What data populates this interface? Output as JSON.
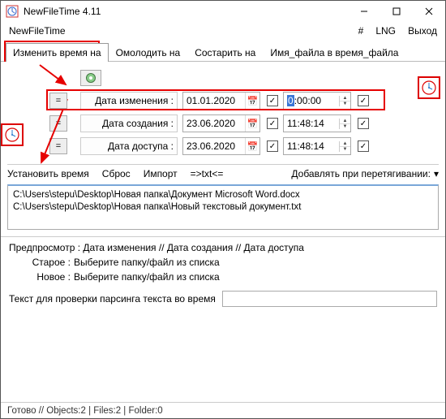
{
  "window": {
    "title": "NewFileTime 4.11"
  },
  "toprow": {
    "appname": "NewFileTime",
    "hash": "#",
    "lng": "LNG",
    "exit": "Выход"
  },
  "tabs": {
    "change": "Изменить время на",
    "young": "Омолодить на",
    "age": "Состарить на",
    "fname": "Имя_файла в время_файла"
  },
  "rows": {
    "eq": "=",
    "mod": {
      "label": "Дата изменения :",
      "date": "01.01.2020",
      "time_prefix": "0",
      "time_rest": ":00:00",
      "chk": "✓"
    },
    "creat": {
      "label": "Дата создания :",
      "date": "23.06.2020",
      "time": "11:48:14",
      "chk": "✓"
    },
    "acc": {
      "label": "Дата доступа :",
      "date": "23.06.2020",
      "time": "11:48:14",
      "chk": "✓"
    }
  },
  "actions": {
    "set": "Установить время",
    "reset": "Сброс",
    "import": "Импорт",
    "txt": "=>txt<=",
    "drag": "Добавлять при перетягивании:"
  },
  "files": {
    "f1": "C:\\Users\\stepu\\Desktop\\Новая папка\\Документ Microsoft Word.docx",
    "f2": "C:\\Users\\stepu\\Desktop\\Новая папка\\Новый текстовый документ.txt"
  },
  "preview": {
    "header": "Предпросмотр :   Дата изменения    //   Дата создания    //   Дата доступа",
    "old_k": "Старое :",
    "old_v": "Выберите папку/файл из списка",
    "new_k": "Новое :",
    "new_v": "Выберите папку/файл из списка",
    "parse": "Текст для проверки парсинга текста во время"
  },
  "status": "Готово // Objects:2 | Files:2 | Folder:0"
}
